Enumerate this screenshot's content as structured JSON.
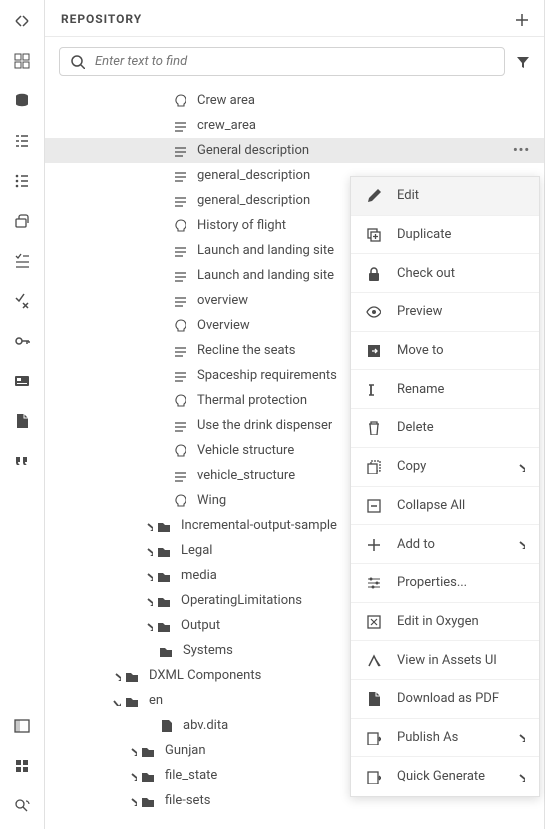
{
  "panel": {
    "title": "REPOSITORY"
  },
  "search": {
    "placeholder": "Enter text to find"
  },
  "tree": [
    {
      "indent": 126,
      "icon": "bulb",
      "label": "Crew area"
    },
    {
      "indent": 126,
      "icon": "topic",
      "label": "crew_area"
    },
    {
      "indent": 126,
      "icon": "topic",
      "label": "General description",
      "selected": true,
      "more": true
    },
    {
      "indent": 126,
      "icon": "topic",
      "label": "general_description"
    },
    {
      "indent": 126,
      "icon": "topic",
      "label": "general_description"
    },
    {
      "indent": 126,
      "icon": "bulb",
      "label": "History of flight"
    },
    {
      "indent": 126,
      "icon": "topic",
      "label": "Launch and landing site"
    },
    {
      "indent": 126,
      "icon": "topic",
      "label": "Launch and landing site"
    },
    {
      "indent": 126,
      "icon": "topic",
      "label": "overview"
    },
    {
      "indent": 126,
      "icon": "bulb",
      "label": "Overview"
    },
    {
      "indent": 126,
      "icon": "topic",
      "label": "Recline the seats"
    },
    {
      "indent": 126,
      "icon": "topic",
      "label": "Spaceship requirements"
    },
    {
      "indent": 126,
      "icon": "bulb",
      "label": "Thermal protection"
    },
    {
      "indent": 126,
      "icon": "topic",
      "label": "Use the drink dispenser"
    },
    {
      "indent": 126,
      "icon": "bulb",
      "label": "Vehicle structure"
    },
    {
      "indent": 126,
      "icon": "topic",
      "label": "vehicle_structure"
    },
    {
      "indent": 126,
      "icon": "bulb",
      "label": "Wing"
    },
    {
      "indent": 96,
      "chev": "right",
      "icon": "folder",
      "label": "Incremental-output-sample"
    },
    {
      "indent": 96,
      "chev": "right",
      "icon": "folder",
      "label": "Legal"
    },
    {
      "indent": 96,
      "chev": "right",
      "icon": "folder",
      "label": "media"
    },
    {
      "indent": 96,
      "chev": "right",
      "icon": "folder",
      "label": "OperatingLimitations"
    },
    {
      "indent": 96,
      "chev": "right",
      "icon": "folder",
      "label": "Output"
    },
    {
      "indent": 112,
      "icon": "folder",
      "label": "Systems"
    },
    {
      "indent": 64,
      "chev": "right",
      "icon": "folder",
      "label": "DXML Components"
    },
    {
      "indent": 64,
      "chev": "down",
      "icon": "folder",
      "label": "en"
    },
    {
      "indent": 112,
      "icon": "file",
      "label": "abv.dita"
    },
    {
      "indent": 80,
      "chev": "right",
      "icon": "folder",
      "label": "Gunjan"
    },
    {
      "indent": 80,
      "chev": "right",
      "icon": "folder",
      "label": "file_state"
    },
    {
      "indent": 80,
      "chev": "right",
      "icon": "folder",
      "label": "file-sets"
    }
  ],
  "menu": [
    {
      "icon": "pencil",
      "label": "Edit",
      "hover": true
    },
    {
      "icon": "duplicate",
      "label": "Duplicate"
    },
    {
      "icon": "lock",
      "label": "Check out"
    },
    {
      "icon": "eye",
      "label": "Preview"
    },
    {
      "icon": "moveto",
      "label": "Move to"
    },
    {
      "icon": "rename",
      "label": "Rename"
    },
    {
      "icon": "trash",
      "label": "Delete"
    },
    {
      "icon": "copy",
      "label": "Copy",
      "sub": true
    },
    {
      "icon": "collapse",
      "label": "Collapse All"
    },
    {
      "icon": "plus",
      "label": "Add to",
      "sub": true
    },
    {
      "icon": "props",
      "label": "Properties..."
    },
    {
      "icon": "oxygen",
      "label": "Edit in Oxygen"
    },
    {
      "icon": "assets",
      "label": "View in Assets UI"
    },
    {
      "icon": "pdf",
      "label": "Download as PDF"
    },
    {
      "icon": "publish",
      "label": "Publish As",
      "sub": true
    },
    {
      "icon": "quick",
      "label": "Quick Generate",
      "sub": true
    }
  ]
}
